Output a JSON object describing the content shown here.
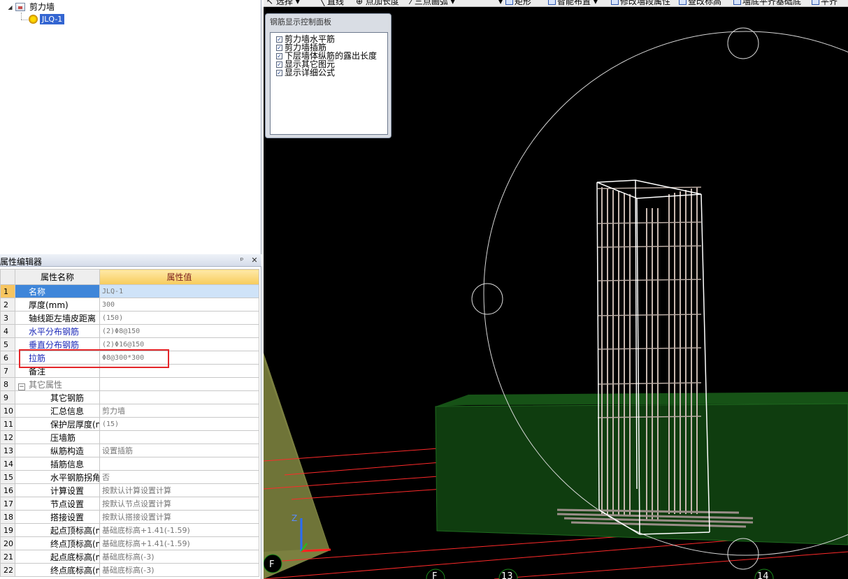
{
  "tree": {
    "root_label": "剪力墙",
    "child_label": "JLQ-1"
  },
  "property_editor": {
    "title": "属性编辑器",
    "pin_icon": "pin-icon",
    "close_icon": "close-icon",
    "header_name": "属性名称",
    "header_value": "属性值",
    "rows": [
      {
        "num": "1",
        "name": "名称",
        "value": "JLQ-1"
      },
      {
        "num": "2",
        "name": "厚度(mm)",
        "value": "300"
      },
      {
        "num": "3",
        "name": "轴线距左墙皮距离",
        "value": "(150)"
      },
      {
        "num": "4",
        "name": "水平分布钢筋",
        "value": "(2)Φ8@150"
      },
      {
        "num": "5",
        "name": "垂直分布钢筋",
        "value": "(2)Φ16@150"
      },
      {
        "num": "6",
        "name": "拉筋",
        "value": "Φ8@300*300"
      },
      {
        "num": "7",
        "name": "备注",
        "value": ""
      },
      {
        "num": "8",
        "name": "其它属性",
        "value": ""
      },
      {
        "num": "9",
        "name": "其它钢筋",
        "value": ""
      },
      {
        "num": "10",
        "name": "汇总信息",
        "value": "剪力墙"
      },
      {
        "num": "11",
        "name": "保护层厚度(mm)",
        "value": "(15)"
      },
      {
        "num": "12",
        "name": "压墙筋",
        "value": ""
      },
      {
        "num": "13",
        "name": "纵筋构造",
        "value": "设置插筋"
      },
      {
        "num": "14",
        "name": "插筋信息",
        "value": ""
      },
      {
        "num": "15",
        "name": "水平钢筋拐角增",
        "value": "否"
      },
      {
        "num": "16",
        "name": "计算设置",
        "value": "按默认计算设置计算"
      },
      {
        "num": "17",
        "name": "节点设置",
        "value": "按默认节点设置计算"
      },
      {
        "num": "18",
        "name": "搭接设置",
        "value": "按默认搭接设置计算"
      },
      {
        "num": "19",
        "name": "起点顶标高(m)",
        "value": "基础底标高+1.41(-1.59)"
      },
      {
        "num": "20",
        "name": "终点顶标高(m)",
        "value": "基础底标高+1.41(-1.59)"
      },
      {
        "num": "21",
        "name": "起点底标高(m)",
        "value": "基础底标高(-3)"
      },
      {
        "num": "22",
        "name": "终点底标高(m)",
        "value": "基础底标高(-3)"
      }
    ]
  },
  "toolbar": {
    "items": [
      "选择",
      "直线",
      "点加长度",
      "三点画弧",
      "矩形",
      "智能布置",
      "修改墙段属性",
      "查改标高",
      "墙底平齐基础底",
      "平齐"
    ]
  },
  "rebar_panel": {
    "title": "钢筋显示控制面板",
    "options": [
      {
        "label": "剪力墙水平筋",
        "checked": true
      },
      {
        "label": "剪力墙插筋",
        "checked": true
      },
      {
        "label": "下层墙体纵筋的露出长度",
        "checked": true
      },
      {
        "label": "显示其它图元",
        "checked": true
      },
      {
        "label": "显示详细公式",
        "checked": true
      }
    ]
  },
  "viewport": {
    "axis_labels": [
      "F",
      "F",
      "13",
      "14"
    ],
    "axis_z_label": "Z",
    "colors": {
      "background": "#000000",
      "foundation": "#0f3d0f",
      "grid_lines": "#ff2a2a",
      "rebar": "#c8b8b0",
      "slope": "#7b8040"
    }
  }
}
